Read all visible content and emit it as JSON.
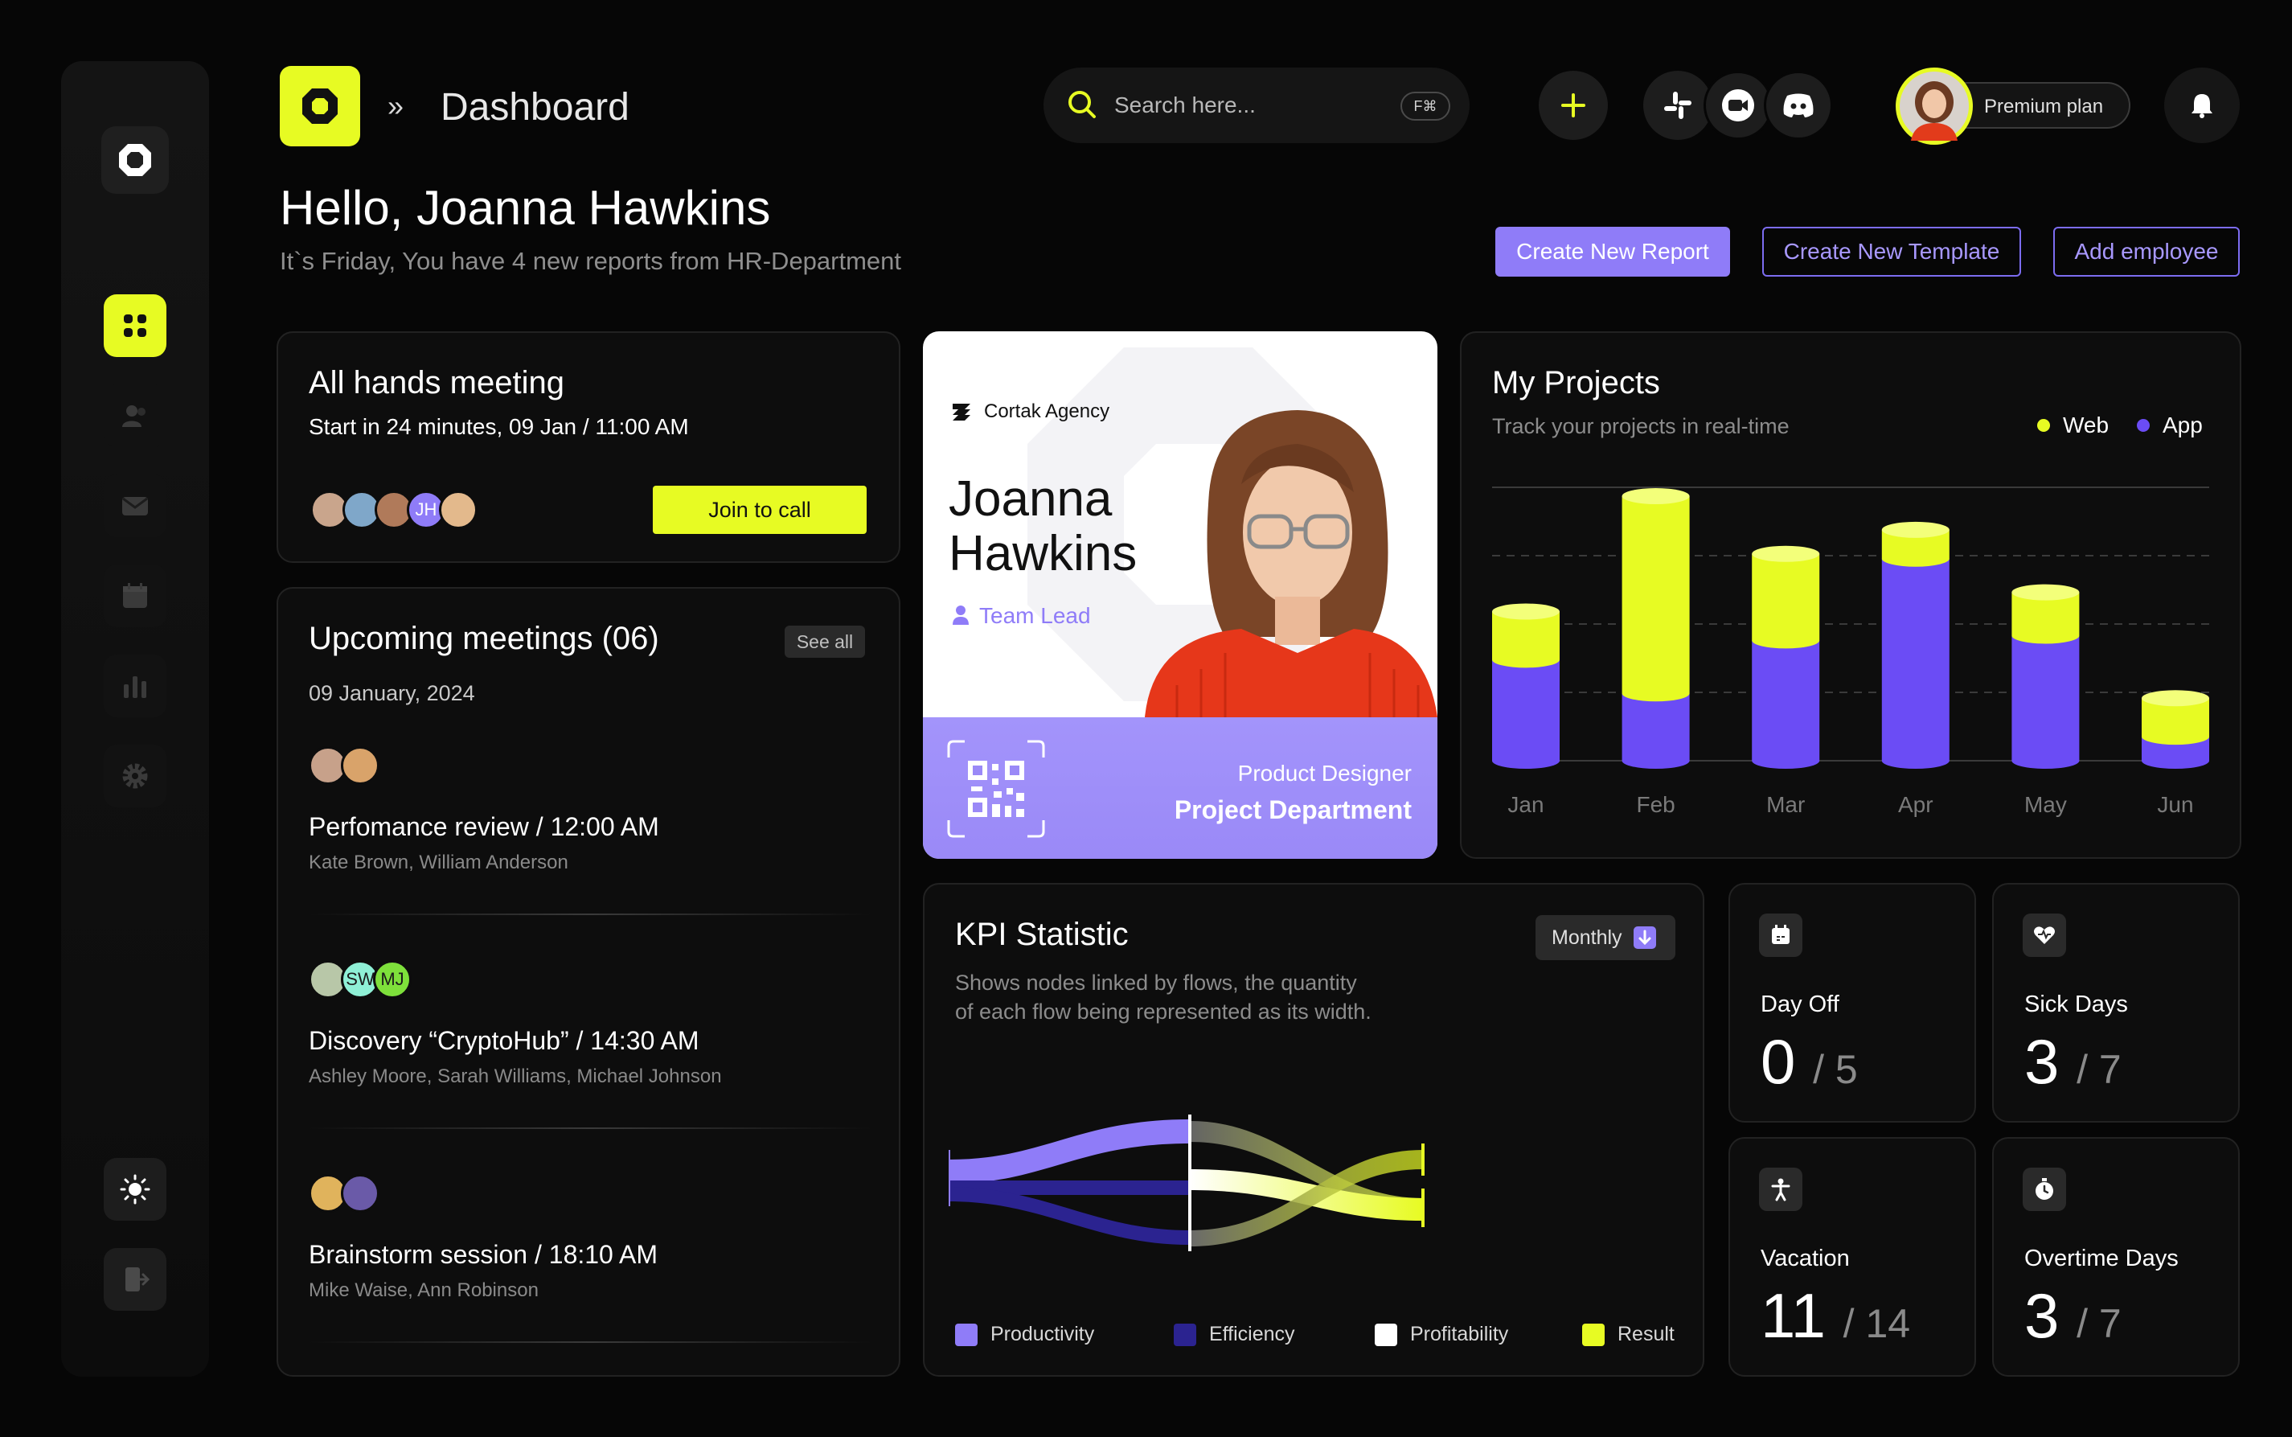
{
  "colors": {
    "accent": "#e7fb23",
    "purple": "#8f7cf8",
    "app": "#6b4cf5",
    "background": "#060606"
  },
  "header": {
    "title": "Dashboard",
    "crumb_separator": "»",
    "search_placeholder": "Search here...",
    "search_shortcut": "F⌘",
    "profile_plan": "Premium plan"
  },
  "greeting": {
    "hello": "Hello, Joanna Hawkins",
    "subtitle": "It`s Friday, You have 4 new reports from HR-Department"
  },
  "actions": {
    "create_report": "Create New Report",
    "create_template": "Create New Template",
    "add_employee": "Add employee"
  },
  "all_hands": {
    "title": "All hands meeting",
    "time": "Start in 24 minutes, 09 Jan / 11:00 AM",
    "attendee_initials": "JH",
    "join_label": "Join to call"
  },
  "upcoming": {
    "title": "Upcoming meetings (06)",
    "see_all": "See all",
    "date": "09 January, 2024",
    "meetings": [
      {
        "title": "Perfomance review / 12:00 AM",
        "people": "Kate Brown, William Anderson",
        "initials": []
      },
      {
        "title": "Discovery “CryptoHub” / 14:30 AM",
        "people": "Ashley Moore, Sarah Williams, Michael Johnson",
        "initials": [
          "SW",
          "MJ"
        ]
      },
      {
        "title": "Brainstorm session  / 18:10 AM",
        "people": "Mike Waise, Ann Robinson",
        "initials": []
      }
    ]
  },
  "id_card": {
    "company": "Cortak Agency",
    "first_name": "Joanna",
    "last_name": "Hawkins",
    "role": "Team Lead",
    "position": "Product Designer",
    "department": "Project Department"
  },
  "projects": {
    "title": "My Projects",
    "subtitle": "Track your projects in real-time",
    "legend_web": "Web",
    "legend_app": "App"
  },
  "chart_data": {
    "type": "bar",
    "stacked": true,
    "categories": [
      "Jan",
      "Feb",
      "Mar",
      "Apr",
      "May",
      "Jun"
    ],
    "series": [
      {
        "name": "App",
        "color": "#6b4cf5",
        "values": [
          42,
          28,
          50,
          84,
          52,
          10
        ]
      },
      {
        "name": "Web",
        "color": "#e7fb23",
        "values": [
          20,
          82,
          36,
          12,
          18,
          16
        ]
      }
    ],
    "ylim": [
      0,
      115
    ],
    "grid": "dashed horizontal",
    "legend": "top-right"
  },
  "kpi": {
    "title": "KPI Statistic",
    "description_line1": "Shows nodes linked by flows, the quantity",
    "description_line2": "of each flow being represented as its width.",
    "period": "Monthly",
    "legend": [
      {
        "label": "Productivity",
        "color": "#8f7cf8"
      },
      {
        "label": "Efficiency",
        "color": "#2b2390"
      },
      {
        "label": "Profitability",
        "color": "#ffffff"
      },
      {
        "label": "Result",
        "color": "#e7fb23"
      }
    ]
  },
  "stats": [
    {
      "label": "Day Off",
      "value": "0",
      "total": "/ 5",
      "icon": "calendar-icon"
    },
    {
      "label": "Sick Days",
      "value": "3",
      "total": "/ 7",
      "icon": "heart-icon"
    },
    {
      "label": "Vacation",
      "value": "11",
      "total": "/ 14",
      "icon": "person-icon"
    },
    {
      "label": "Overtime Days",
      "value": "3",
      "total": "/ 7",
      "icon": "stopwatch-icon"
    }
  ]
}
